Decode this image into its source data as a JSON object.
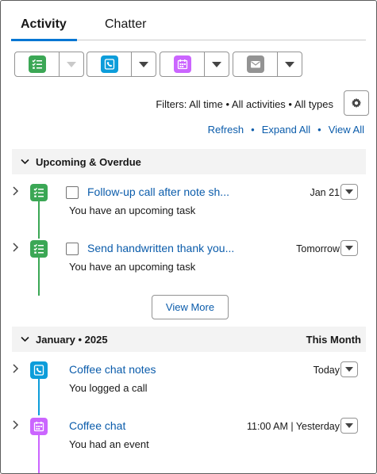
{
  "tabs": [
    {
      "label": "Activity",
      "active": true
    },
    {
      "label": "Chatter",
      "active": false
    }
  ],
  "toolbar": {
    "buttons": [
      {
        "name": "new-task",
        "icon": "task-icon",
        "color": "#3ba755",
        "dropdown_enabled": false
      },
      {
        "name": "log-call",
        "icon": "call-icon",
        "color": "#0d9dda",
        "dropdown_enabled": true
      },
      {
        "name": "new-event",
        "icon": "event-icon",
        "color": "#cb65ff",
        "dropdown_enabled": true
      },
      {
        "name": "email",
        "icon": "email-icon",
        "color": "#939393",
        "dropdown_enabled": true
      }
    ]
  },
  "filters": {
    "text": "Filters: All time • All activities • All types"
  },
  "actions": {
    "refresh": "Refresh",
    "expand_all": "Expand All",
    "view_all": "View All",
    "separator": "•"
  },
  "sections": [
    {
      "title": "Upcoming & Overdue",
      "right": "",
      "items": [
        {
          "type": "task",
          "subject": "Follow-up call after note sh...",
          "date": "Jan 21",
          "description": "You have an upcoming task"
        },
        {
          "type": "task",
          "subject": "Send handwritten thank you...",
          "date": "Tomorrow",
          "description": "You have an upcoming task"
        }
      ],
      "view_more": "View More"
    },
    {
      "title": "January • 2025",
      "right": "This Month",
      "items": [
        {
          "type": "call",
          "subject": "Coffee chat notes",
          "date": "Today",
          "description": "You logged a call"
        },
        {
          "type": "event",
          "subject": "Coffee chat",
          "date": "11:00 AM | Yesterday",
          "description": "You had an event"
        }
      ]
    }
  ],
  "colors": {
    "task": "#3ba755",
    "call": "#0d9dda",
    "event": "#cb65ff",
    "email": "#939393",
    "link": "#0b5cab",
    "accent": "#0176d3"
  }
}
